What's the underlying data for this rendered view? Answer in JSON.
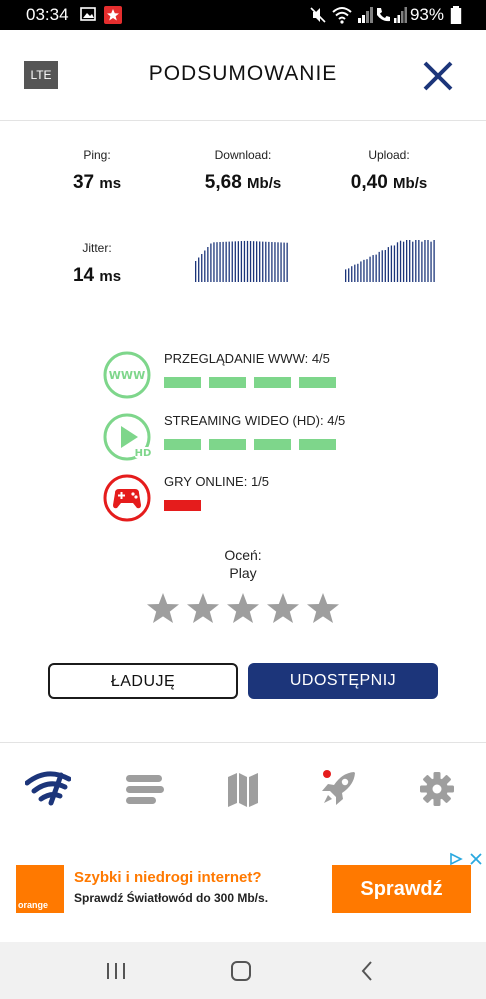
{
  "status_bar": {
    "time": "03:34",
    "battery": "93%",
    "icons": [
      "gallery-icon",
      "notification-icon",
      "mute-icon",
      "wifi-icon",
      "call-icon",
      "signal-icon",
      "battery-icon"
    ]
  },
  "header": {
    "badge": "LTE",
    "title": "PODSUMOWANIE",
    "close_icon": "close-icon"
  },
  "results": {
    "ping": {
      "label": "Ping:",
      "value": "37",
      "unit": "ms"
    },
    "download": {
      "label": "Download:",
      "value": "5,68",
      "unit": "Mb/s"
    },
    "upload": {
      "label": "Upload:",
      "value": "0,40",
      "unit": "Mb/s"
    },
    "jitter": {
      "label": "Jitter:",
      "value": "14",
      "unit": "ms"
    }
  },
  "quality": [
    {
      "label": "PRZEGLĄDANIE WWW: 4/5",
      "score": 4,
      "max": 5,
      "icon": "www-icon",
      "color": "#7ed68b",
      "icon_color": "#7ed68b"
    },
    {
      "label": "STREAMING WIDEO (HD): 4/5",
      "score": 4,
      "max": 5,
      "icon": "play-hd-icon",
      "color": "#7ed68b",
      "icon_color": "#7ed68b"
    },
    {
      "label": "GRY ONLINE: 1/5",
      "score": 1,
      "max": 5,
      "icon": "gamepad-icon",
      "color": "#e51c1c",
      "icon_color": "#e51c1c"
    }
  ],
  "rating": {
    "label": "Oceń:",
    "sub": "Play",
    "stars": 5,
    "filled": 0
  },
  "buttons": {
    "loading": "ŁADUJĘ",
    "share": "UDOSTĘPNIJ"
  },
  "bottom_nav": [
    {
      "icon": "speedtest-icon",
      "active": true
    },
    {
      "icon": "history-icon",
      "active": false
    },
    {
      "icon": "map-icon",
      "active": false
    },
    {
      "icon": "rocket-icon",
      "active": false,
      "badge": true
    },
    {
      "icon": "settings-icon",
      "active": false
    }
  ],
  "ad": {
    "logo": "orange",
    "headline": "Szybki i niedrogi internet?",
    "sub": "Sprawdź Światłowód do 300 Mb/s.",
    "cta": "Sprawdź"
  },
  "colors": {
    "brand_navy": "#1c357a",
    "good": "#7ed68b",
    "bad": "#e51c1c",
    "orange": "#ff7900",
    "inactive_icon": "#9e9e9e"
  }
}
